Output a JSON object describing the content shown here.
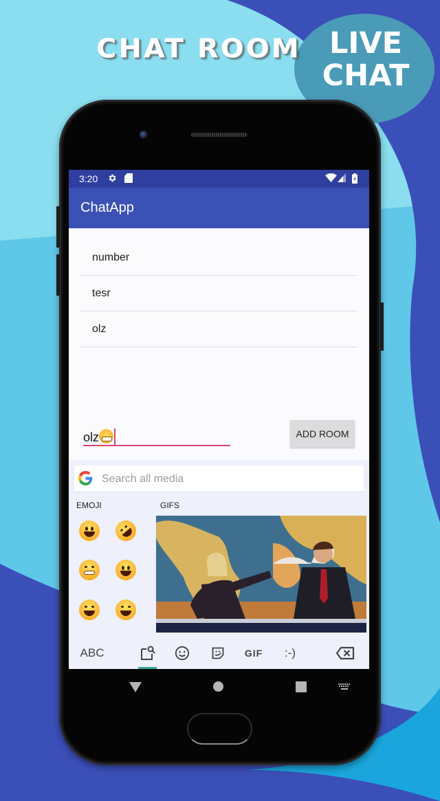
{
  "promo": {
    "headline": "CHAT ROOM",
    "bubble_line1": "LIVE",
    "bubble_line2": "CHAT",
    "colors": {
      "bg_light": "#8fe0f0",
      "bg_dark": "#3b4fb8",
      "bubble": "#4a9bb8"
    }
  },
  "statusbar": {
    "time": "3:20",
    "left_icons": [
      "settings-icon",
      "sd-card-icon"
    ],
    "right_icons": [
      "wifi-icon",
      "cell-signal-icon",
      "battery-charging-icon"
    ]
  },
  "appbar": {
    "title": "ChatApp",
    "color": "#3b51b5"
  },
  "rooms": [
    {
      "name": "number"
    },
    {
      "name": "tesr"
    },
    {
      "name": "olz"
    }
  ],
  "room_input": {
    "value": "olz",
    "trailing_emoji": "grinning-face-with-smiling-eyes",
    "accent": "#d8457a"
  },
  "add_room_button": {
    "label": "ADD ROOM"
  },
  "keyboard": {
    "search_placeholder": "Search all media",
    "emoji_label": "EMOJI",
    "gifs_label": "GIFS",
    "emojis": [
      "grinning-face-big-eyes",
      "rolling-on-floor-laughing",
      "beaming-face",
      "grinning-face",
      "face-with-tears-of-joy",
      "grinning-face-smiling-eyes"
    ],
    "gif_description": "two news anchors high-fiving at a desk in front of a world map",
    "tabs": [
      {
        "id": "abc",
        "label": "ABC"
      },
      {
        "id": "search",
        "icon": "sticker-search-icon",
        "active": true
      },
      {
        "id": "emoji",
        "icon": "emoji-icon"
      },
      {
        "id": "sticker",
        "icon": "sticker-icon"
      },
      {
        "id": "gif",
        "label": "GIF"
      },
      {
        "id": "emoticon",
        "label": ":-)"
      },
      {
        "id": "backspace",
        "icon": "backspace-icon"
      }
    ],
    "active_color": "#3aa89a"
  },
  "navbar": {
    "buttons": [
      "back",
      "home",
      "recents",
      "keyboard-switch"
    ]
  }
}
